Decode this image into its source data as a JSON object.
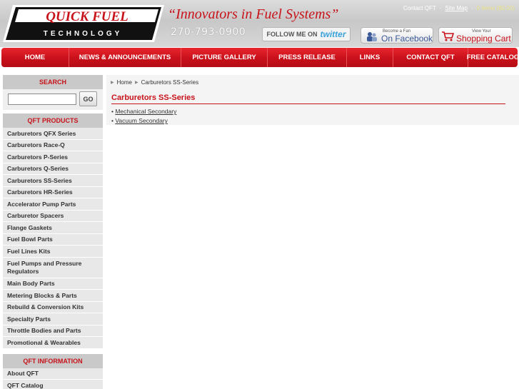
{
  "header": {
    "logo_text_main": "QUICK FUEL",
    "logo_text_sub": "TECHNOLOGY",
    "tagline": "“Innovators in Fuel Systems”",
    "phone": "270-793-0900",
    "top_links": {
      "contact": "Contact QFT",
      "site_map": "Site Map",
      "cart_status": "0 items ($0.00)"
    },
    "twitter": {
      "label": "FOLLOW ME ON",
      "brand": "twitter"
    },
    "facebook": {
      "small": "Become a Fan",
      "big": "On Facebook"
    },
    "cart": {
      "small": "View Your",
      "big": "Shopping Cart"
    }
  },
  "nav": {
    "items": [
      "HOME",
      "NEWS & ANNOUNCEMENTS",
      "PICTURE GALLERY",
      "PRESS RELEASE",
      "LINKS",
      "CONTACT QFT",
      "FREE CATALOG"
    ]
  },
  "sidebar": {
    "search_heading": "SEARCH",
    "search_value": "",
    "go_label": "GO",
    "products_heading": "QFT PRODUCTS",
    "products": [
      "Carburetors QFX Series",
      "Carburetors Race-Q",
      "Carburetors P-Series",
      "Carburetors Q-Series",
      "Carburetors SS-Series",
      "Carburetors HR-Series",
      "Accelerator Pump Parts",
      "Carburetor Spacers",
      "Flange Gaskets",
      "Fuel Bowl Parts",
      "Fuel Lines Kits",
      "Fuel Pumps and Pressure Regulators",
      "Main Body Parts",
      "Metering Blocks & Parts",
      "Rebuild & Conversion Kits",
      "Specialty Parts",
      "Throttle Bodies and Parts",
      "Promotional & Wearables"
    ],
    "info_heading": "QFT INFORMATION",
    "info": [
      "About QFT",
      "QFT Catalog"
    ]
  },
  "main": {
    "breadcrumb": [
      "Home",
      "Carburetors SS-Series"
    ],
    "title": "Carburetors SS-Series",
    "links": [
      "Mechanical Secondary",
      "Vacuum Secondary"
    ]
  },
  "colors": {
    "brand_red": "#c8121a",
    "nav_red": "#d0141d",
    "sidebar_bg": "#e8e8e8"
  }
}
